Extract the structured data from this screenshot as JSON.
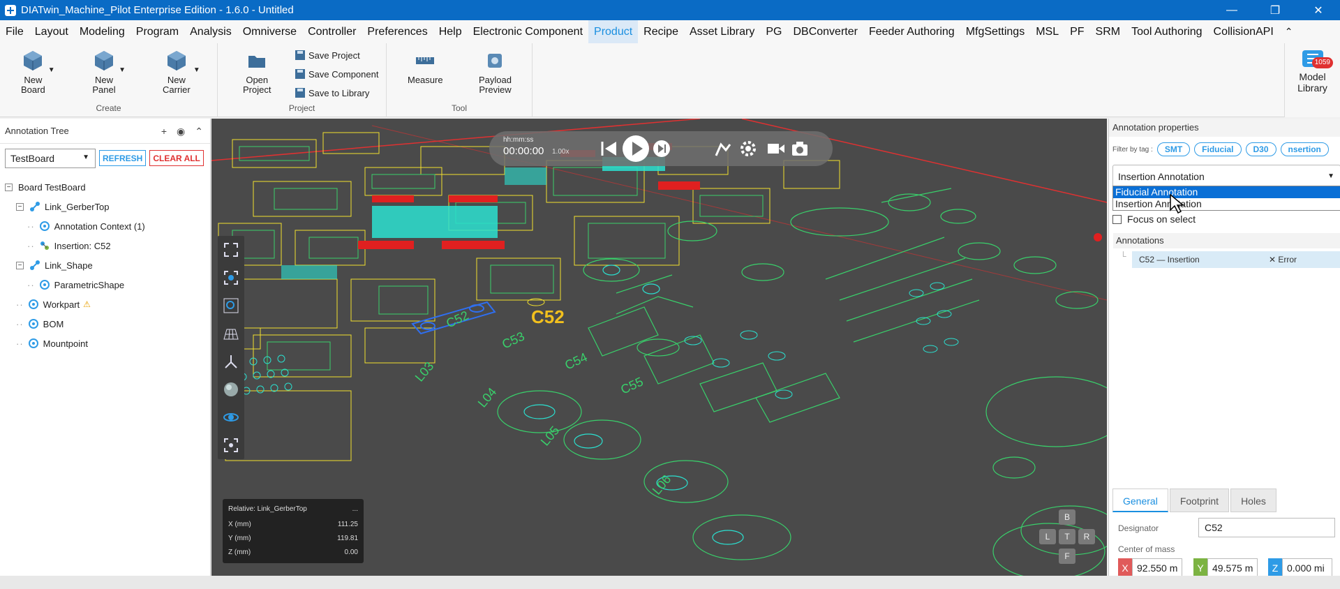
{
  "titlebar": {
    "title": "DIATwin_Machine_Pilot Enterprise Edition - 1.6.0 - Untitled",
    "controls": [
      "minimize-icon",
      "restore-icon",
      "close-icon"
    ]
  },
  "menu": {
    "items": [
      "File",
      "Layout",
      "Modeling",
      "Program",
      "Analysis",
      "Omniverse",
      "Controller",
      "Preferences",
      "Help",
      "Electronic Component",
      "Product",
      "Recipe",
      "Asset Library",
      "PG",
      "DBConverter",
      "Feeder Authoring",
      "MfgSettings",
      "MSL",
      "PF",
      "SRM",
      "Tool Authoring",
      "CollisionAPI"
    ],
    "active": "Product"
  },
  "ribbon": {
    "create": {
      "label": "Create",
      "new_board": "New\nBoard",
      "new_panel": "New\nPanel",
      "new_carrier": "New\nCarrier"
    },
    "project": {
      "label": "Project",
      "open_project": "Open\nProject",
      "save_project": "Save Project",
      "save_component": "Save Component",
      "save_to_library": "Save to Library"
    },
    "tool": {
      "label": "Tool",
      "measure": "Measure",
      "payload_preview": "Payload\nPreview"
    },
    "model_library": {
      "label": "Model\nLibrary",
      "badge": "1059"
    }
  },
  "annotation_tree": {
    "title": "Annotation Tree",
    "board_select": "TestBoard",
    "refresh": "REFRESH",
    "clear_all": "CLEAR ALL",
    "nodes": [
      {
        "label": "Board  TestBoard",
        "indent": 0,
        "expander": "−",
        "icon": ""
      },
      {
        "label": "Link_GerberTop",
        "indent": 1,
        "expander": "−",
        "icon": "link-icon"
      },
      {
        "label": "Annotation Context (1)",
        "indent": 2,
        "expander": "",
        "icon": "target-icon"
      },
      {
        "label": "Insertion: C52",
        "indent": 2,
        "expander": "",
        "icon": "component-icon"
      },
      {
        "label": "Link_Shape",
        "indent": 1,
        "expander": "−",
        "icon": "link-icon"
      },
      {
        "label": "ParametricShape",
        "indent": 2,
        "expander": "",
        "icon": "target-icon"
      },
      {
        "label": "Workpart",
        "indent": 1,
        "expander": "",
        "icon": "target-icon",
        "warning": "⚠"
      },
      {
        "label": "BOM",
        "indent": 1,
        "expander": "",
        "icon": "target-icon"
      },
      {
        "label": "Mountpoint",
        "indent": 1,
        "expander": "",
        "icon": "target-icon"
      }
    ]
  },
  "viewport": {
    "playbar": {
      "time_label": "hh:mm:ss",
      "time": "00:00:00",
      "speed": "1.00x"
    },
    "component_label": "C52",
    "coords": {
      "title": "Relative: Link_GerberTop",
      "menu": "...",
      "x_label": "X (mm)",
      "x": "111.25",
      "y_label": "Y (mm)",
      "y": "119.81",
      "z_label": "Z (mm)",
      "z": "0.00"
    },
    "navcube": {
      "top": "B",
      "left": "L",
      "center": "T",
      "right": "R",
      "bottom": "F"
    },
    "pcb_labels": [
      "C52",
      "C53",
      "C54",
      "C55",
      "L03",
      "L04",
      "L05",
      "L06"
    ]
  },
  "annotation_properties": {
    "title": "Annotation properties",
    "filter_label": "Filter by tag :",
    "tags": [
      "SMT",
      "Fiducial",
      "D30",
      "nsertion"
    ],
    "type_select": "Insertion Annotation",
    "dropdown_options": [
      "Fiducial Annotation",
      "Insertion Annotation"
    ],
    "dropdown_selected": "Fiducial Annotation",
    "focus_on_select": "Focus on select",
    "annotations_header": "Annotations",
    "annotation_row": {
      "name": "C52 — Insertion",
      "status": "✕ Error"
    },
    "tabs": [
      "General",
      "Footprint",
      "Holes"
    ],
    "active_tab": "General",
    "designator_label": "Designator",
    "designator": "C52",
    "center_of_mass_label": "Center of mass",
    "com": {
      "x_label": "X",
      "x": "92.550 m",
      "y_label": "Y",
      "y": "49.575 m",
      "z_label": "Z",
      "z": "0.000 mi"
    },
    "axis_colors": {
      "x": "#e05a5a",
      "y": "#7cb342",
      "z": "#2e9be6"
    }
  }
}
